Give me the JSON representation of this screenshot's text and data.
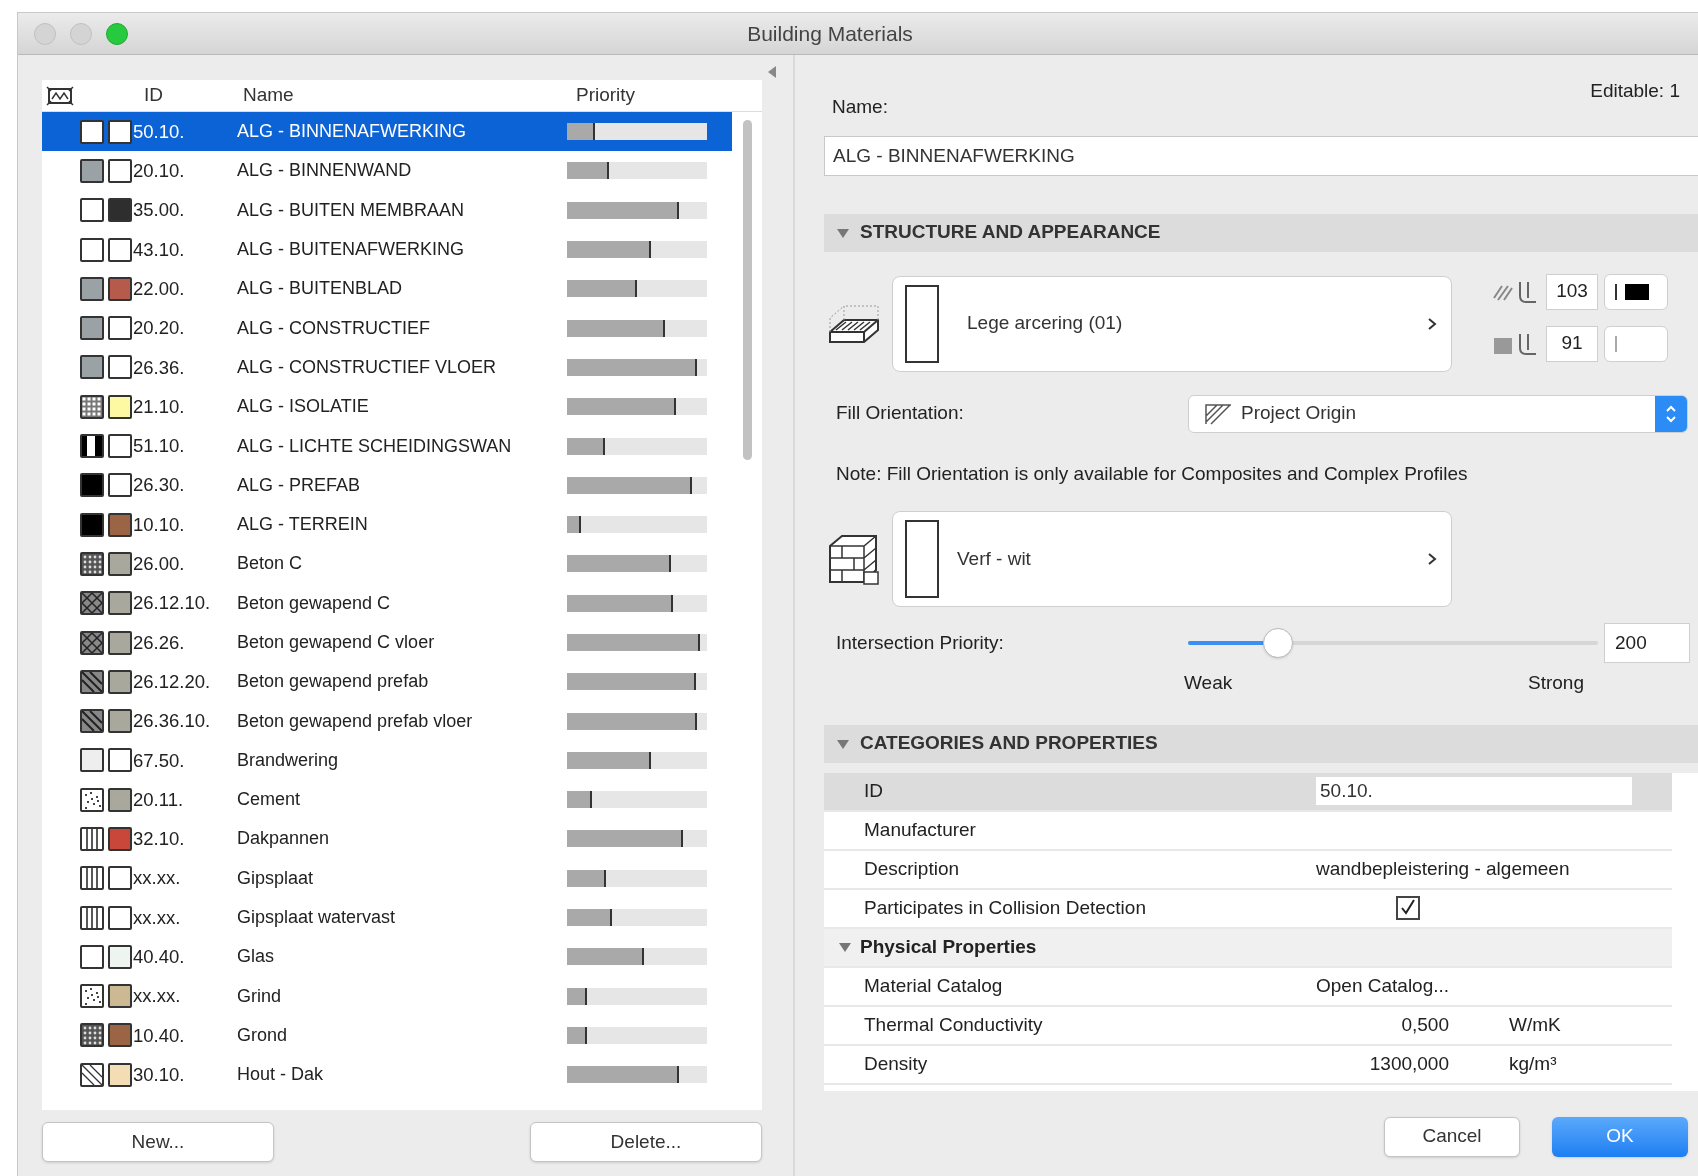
{
  "window": {
    "title": "Building Materials"
  },
  "materials": {
    "columns": [
      "ID",
      "Name",
      "Priority"
    ],
    "rows": [
      {
        "id": "50.10.",
        "name": "ALG - BINNENAFWERKING",
        "kind": "empty",
        "color": "#ffffff",
        "level": 0.2,
        "selected": true
      },
      {
        "id": "20.10.",
        "name": "ALG - BINNENWAND",
        "kind": "grey",
        "color": "#ffffff",
        "level": 0.3,
        "selected": false
      },
      {
        "id": "35.00.",
        "name": "ALG - BUITEN MEMBRAAN",
        "kind": "empty",
        "color": "#2e2e2e",
        "level": 0.8,
        "selected": false
      },
      {
        "id": "43.10.",
        "name": "ALG - BUITENAFWERKING",
        "kind": "empty",
        "color": "#ffffff",
        "level": 0.6,
        "selected": false
      },
      {
        "id": "22.00.",
        "name": "ALG - BUITENBLAD",
        "kind": "grey",
        "color": "#b65a4c",
        "level": 0.5,
        "selected": false
      },
      {
        "id": "20.20.",
        "name": "ALG - CONSTRUCTIEF",
        "kind": "grey",
        "color": "#ffffff",
        "level": 0.7,
        "selected": false
      },
      {
        "id": "26.36.",
        "name": "ALG - CONSTRUCTIEF VLOER",
        "kind": "grey",
        "color": "#ffffff",
        "level": 0.93,
        "selected": false
      },
      {
        "id": "21.10.",
        "name": "ALG - ISOLATIE",
        "kind": "checker",
        "color": "#fdf9a3",
        "level": 0.78,
        "selected": false
      },
      {
        "id": "51.10.",
        "name": "ALG - LICHTE SCHEIDINGSWAN",
        "kind": "bars",
        "color": "#ffffff",
        "level": 0.27,
        "selected": false
      },
      {
        "id": "26.30.",
        "name": "ALG - PREFAB",
        "kind": "black",
        "color": "#ffffff",
        "level": 0.89,
        "selected": false
      },
      {
        "id": "10.10.",
        "name": "ALG - TERREIN",
        "kind": "black",
        "color": "#9a6445",
        "level": 0.1,
        "selected": false
      },
      {
        "id": "26.00.",
        "name": "Beton C",
        "kind": "dots",
        "color": "#a8a89c",
        "level": 0.74,
        "selected": false
      },
      {
        "id": "26.12.10.",
        "name": "Beton gewapend C",
        "kind": "cross",
        "color": "#a8a89c",
        "level": 0.76,
        "selected": false
      },
      {
        "id": "26.26.",
        "name": "Beton gewapend C vloer",
        "kind": "cross",
        "color": "#a8a89c",
        "level": 0.95,
        "selected": false
      },
      {
        "id": "26.12.20.",
        "name": "Beton gewapend prefab",
        "kind": "diagonal",
        "color": "#a8a89c",
        "level": 0.92,
        "selected": false
      },
      {
        "id": "26.36.10.",
        "name": "Beton gewapend prefab vloer",
        "kind": "diagonal",
        "color": "#a8a89c",
        "level": 0.93,
        "selected": false
      },
      {
        "id": "67.50.",
        "name": "Brandwering",
        "kind": "light",
        "color": "#ffffff",
        "level": 0.6,
        "selected": false
      },
      {
        "id": "20.11.",
        "name": "Cement",
        "kind": "speckle",
        "color": "#a8a89c",
        "level": 0.18,
        "selected": false
      },
      {
        "id": "32.10.",
        "name": "Dakpannen",
        "kind": "vlines",
        "color": "#c8463a",
        "level": 0.83,
        "selected": false
      },
      {
        "id": "xx.xx.",
        "name": "Gipsplaat",
        "kind": "vlines",
        "color": "#ffffff",
        "level": 0.28,
        "selected": false
      },
      {
        "id": "xx.xx.",
        "name": "Gipsplaat watervast",
        "kind": "vlines",
        "color": "#ffffff",
        "level": 0.32,
        "selected": false
      },
      {
        "id": "40.40.",
        "name": "Glas",
        "kind": "empty",
        "color": "#eef4f0",
        "level": 0.55,
        "selected": false
      },
      {
        "id": "xx.xx.",
        "name": "Grind",
        "kind": "speckle",
        "color": "#cdb894",
        "level": 0.14,
        "selected": false
      },
      {
        "id": "10.40.",
        "name": "Grond",
        "kind": "dots",
        "color": "#9a6445",
        "level": 0.14,
        "selected": false
      },
      {
        "id": "30.10.",
        "name": "Hout - Dak",
        "kind": "diagonal-light",
        "color": "#f4dcb4",
        "level": 0.8,
        "selected": false
      }
    ]
  },
  "left_buttons": [
    "New...",
    "Delete..."
  ],
  "editable": "Editable: 1",
  "name_field": {
    "label": "Name:",
    "value": "ALG - BINNENAFWERKING"
  },
  "structure": {
    "title": "STRUCTURE AND APPEARANCE",
    "expanded": true,
    "cut_fill": {
      "label": "Lege arcering (01)",
      "pen_fg": "103",
      "pen_bg": "91"
    },
    "fill_orientation": {
      "label": "Fill Orientation:",
      "value": "Project Origin"
    },
    "note": "Note: Fill Orientation is only available for Composites and Complex Profiles",
    "surface": {
      "label": "Verf - wit"
    },
    "priority": {
      "label": "Intersection Priority:",
      "level": 0.22,
      "value": "200",
      "min_label": "Weak",
      "max_label": "Strong"
    }
  },
  "categories": {
    "title": "CATEGORIES AND PROPERTIES",
    "expanded": true,
    "rows": [
      {
        "kind": "field",
        "label": "ID",
        "value": "50.10.",
        "selected": true
      },
      {
        "kind": "text",
        "label": "Manufacturer",
        "selected": false
      },
      {
        "kind": "text",
        "label": "Description",
        "value": "wandbepleistering - algemeen",
        "selected": false
      },
      {
        "kind": "check",
        "label": "Participates in Collision Detection",
        "checked": true,
        "selected": false
      },
      {
        "kind": "group",
        "label": "Physical Properties",
        "expanded": true,
        "selected": false
      },
      {
        "kind": "text",
        "label": "Material Catalog",
        "value": "Open Catalog...",
        "selected": false
      },
      {
        "kind": "measure",
        "label": "Thermal Conductivity",
        "value": "0,500",
        "unit": "W/mK",
        "selected": false
      },
      {
        "kind": "measure",
        "label": "Density",
        "value": "1300,000",
        "unit": "kg/m³",
        "selected": false
      }
    ]
  },
  "dialog_buttons": [
    "Cancel",
    "OK"
  ]
}
